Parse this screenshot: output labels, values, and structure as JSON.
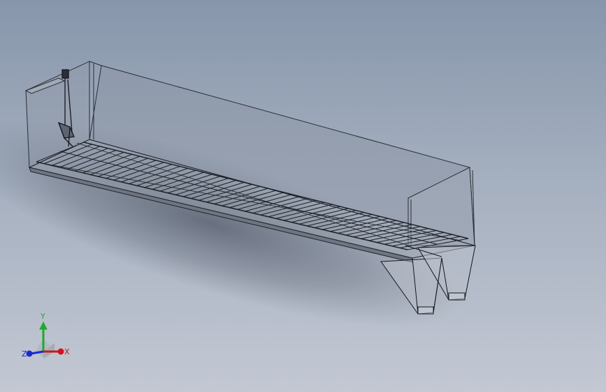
{
  "viewport": {
    "background_top": "#8796ab",
    "background_bottom": "#c3c8d3"
  },
  "triad": {
    "x_label": "X",
    "y_label": "Y",
    "z_label": "Z",
    "x_color": "#d0141e",
    "y_color": "#1faa2a",
    "z_color": "#1a2ad0"
  },
  "model": {
    "name": "",
    "slat_count": 48
  }
}
